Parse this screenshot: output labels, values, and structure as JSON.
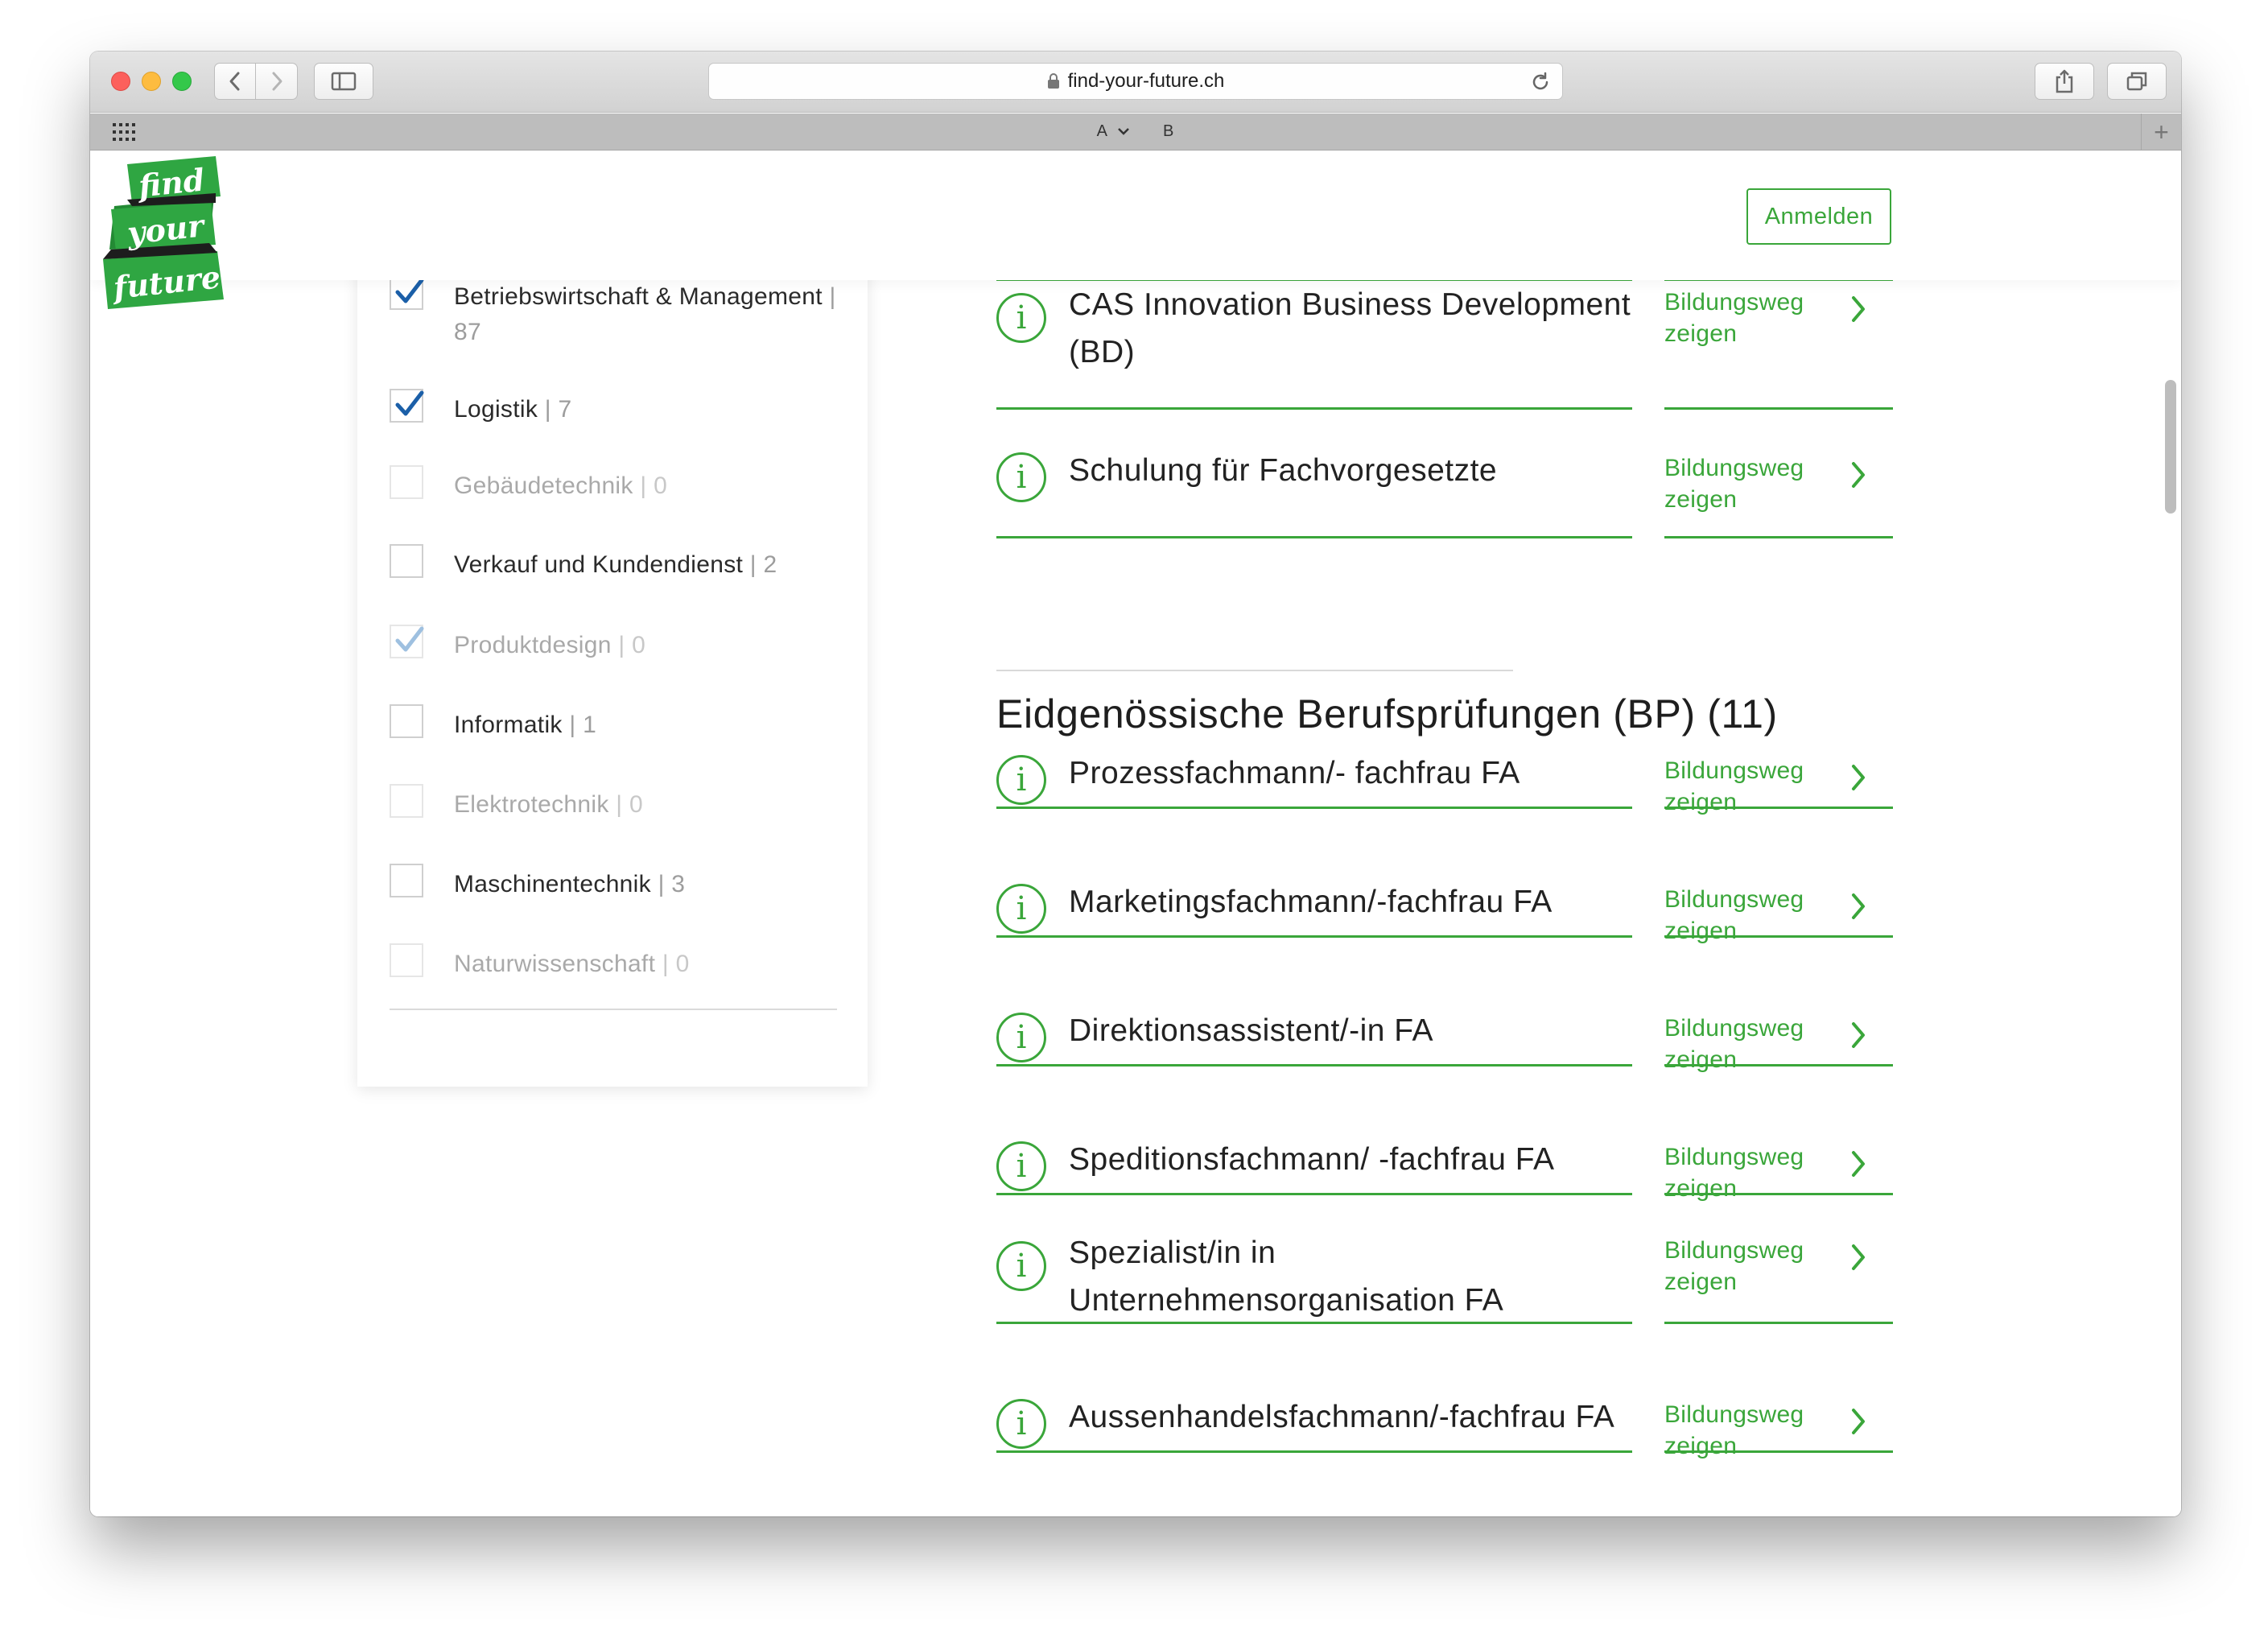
{
  "browser": {
    "url": "find-your-future.ch",
    "tab_label_a": "A",
    "tab_label_b": "B"
  },
  "logo": {
    "line1": "find",
    "line2": "your",
    "line3": "future"
  },
  "header": {
    "login_label": "Anmelden"
  },
  "filters": [
    {
      "label": "Betriebswirtschaft & Management",
      "count": "| 87",
      "checked": true,
      "disabled": false
    },
    {
      "label": "Logistik",
      "count": "| 7",
      "checked": true,
      "disabled": false
    },
    {
      "label": "Gebäudetechnik",
      "count": "| 0",
      "checked": false,
      "disabled": true
    },
    {
      "label": "Verkauf und Kundendienst",
      "count": "| 2",
      "checked": false,
      "disabled": false
    },
    {
      "label": "Produktdesign",
      "count": "| 0",
      "checked": true,
      "disabled": true
    },
    {
      "label": "Informatik",
      "count": "| 1",
      "checked": false,
      "disabled": false
    },
    {
      "label": "Elektrotechnik",
      "count": "| 0",
      "checked": false,
      "disabled": true
    },
    {
      "label": "Maschinentechnik",
      "count": "| 3",
      "checked": false,
      "disabled": false
    },
    {
      "label": "Naturwissenschaft",
      "count": "| 0",
      "checked": false,
      "disabled": true
    }
  ],
  "top_results": [
    {
      "title": "CAS Innovation Business Development (BD)",
      "link": "Bildungsweg zeigen"
    },
    {
      "title": "Schulung für Fachvorgesetzte",
      "link": "Bildungsweg zeigen"
    }
  ],
  "section": {
    "title": "Eidgenössische Berufsprüfungen (BP) (11)"
  },
  "bp_results": [
    {
      "title": "Prozessfachmann/- fachfrau FA",
      "link": "Bildungsweg zeigen"
    },
    {
      "title": "Marketingsfachmann/-fachfrau FA",
      "link": "Bildungsweg zeigen"
    },
    {
      "title": "Direktionsassistent/-in FA",
      "link": "Bildungsweg zeigen"
    },
    {
      "title": "Speditionsfachmann/ -fachfrau FA",
      "link": "Bildungsweg zeigen"
    },
    {
      "title": "Spezialist/in in Unternehmensorganisation FA",
      "link": "Bildungsweg zeigen"
    },
    {
      "title": "Aussenhandelsfachmann/-fachfrau FA",
      "link": "Bildungsweg zeigen"
    }
  ],
  "colors": {
    "brand_green": "#3aa63a",
    "check_blue": "#1b5fa8",
    "check_blue_faded": "#9ec0e0"
  }
}
